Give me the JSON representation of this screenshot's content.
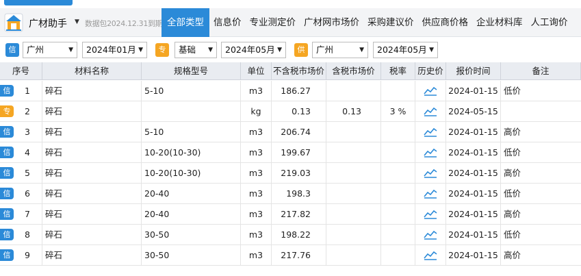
{
  "app": {
    "title": "广材助手",
    "package_notice": "数据包2024.12.31到期"
  },
  "nav": [
    {
      "label": "全部类型",
      "active": true
    },
    {
      "label": "信息价",
      "active": false
    },
    {
      "label": "专业测定价",
      "active": false
    },
    {
      "label": "广材网市场价",
      "active": false
    },
    {
      "label": "采购建议价",
      "active": false
    },
    {
      "label": "供应商价格",
      "active": false
    },
    {
      "label": "企业材料库",
      "active": false
    },
    {
      "label": "人工询价",
      "active": false
    }
  ],
  "filters": {
    "info": {
      "badge": "信",
      "region": "广州",
      "period": "2024年01月"
    },
    "pro": {
      "badge": "专",
      "category": "基础",
      "period": "2024年05月"
    },
    "supply": {
      "badge": "供",
      "region": "广州",
      "period": "2024年05月"
    }
  },
  "colors": {
    "accent": "#2b8ad8",
    "pro_badge": "#f5a623",
    "trend_icon": "#2b8ad8"
  },
  "table": {
    "headers": [
      "序号",
      "材料名称",
      "规格型号",
      "单位",
      "不含税市场价",
      "含税市场价",
      "税率",
      "历史价",
      "报价时间",
      "备注"
    ],
    "rows": [
      {
        "badge": "信",
        "no": "1",
        "name": "碎石",
        "spec": "5-10",
        "unit": "m3",
        "price_ex": "186.27",
        "price_in": "",
        "rate": "",
        "date": "2024-01-15",
        "note": "低价"
      },
      {
        "badge": "专",
        "no": "2",
        "name": "碎石",
        "spec": "",
        "unit": "kg",
        "price_ex": "0.13",
        "price_in": "0.13",
        "rate": "3 %",
        "date": "2024-05-15",
        "note": ""
      },
      {
        "badge": "信",
        "no": "3",
        "name": "碎石",
        "spec": "5-10",
        "unit": "m3",
        "price_ex": "206.74",
        "price_in": "",
        "rate": "",
        "date": "2024-01-15",
        "note": "高价"
      },
      {
        "badge": "信",
        "no": "4",
        "name": "碎石",
        "spec": "10-20(10-30)",
        "unit": "m3",
        "price_ex": "199.67",
        "price_in": "",
        "rate": "",
        "date": "2024-01-15",
        "note": "低价"
      },
      {
        "badge": "信",
        "no": "5",
        "name": "碎石",
        "spec": "10-20(10-30)",
        "unit": "m3",
        "price_ex": "219.03",
        "price_in": "",
        "rate": "",
        "date": "2024-01-15",
        "note": "高价"
      },
      {
        "badge": "信",
        "no": "6",
        "name": "碎石",
        "spec": "20-40",
        "unit": "m3",
        "price_ex": "198.3",
        "price_in": "",
        "rate": "",
        "date": "2024-01-15",
        "note": "低价"
      },
      {
        "badge": "信",
        "no": "7",
        "name": "碎石",
        "spec": "20-40",
        "unit": "m3",
        "price_ex": "217.82",
        "price_in": "",
        "rate": "",
        "date": "2024-01-15",
        "note": "高价"
      },
      {
        "badge": "信",
        "no": "8",
        "name": "碎石",
        "spec": "30-50",
        "unit": "m3",
        "price_ex": "198.22",
        "price_in": "",
        "rate": "",
        "date": "2024-01-15",
        "note": "低价"
      },
      {
        "badge": "信",
        "no": "9",
        "name": "碎石",
        "spec": "30-50",
        "unit": "m3",
        "price_ex": "217.76",
        "price_in": "",
        "rate": "",
        "date": "2024-01-15",
        "note": "高价"
      }
    ]
  }
}
